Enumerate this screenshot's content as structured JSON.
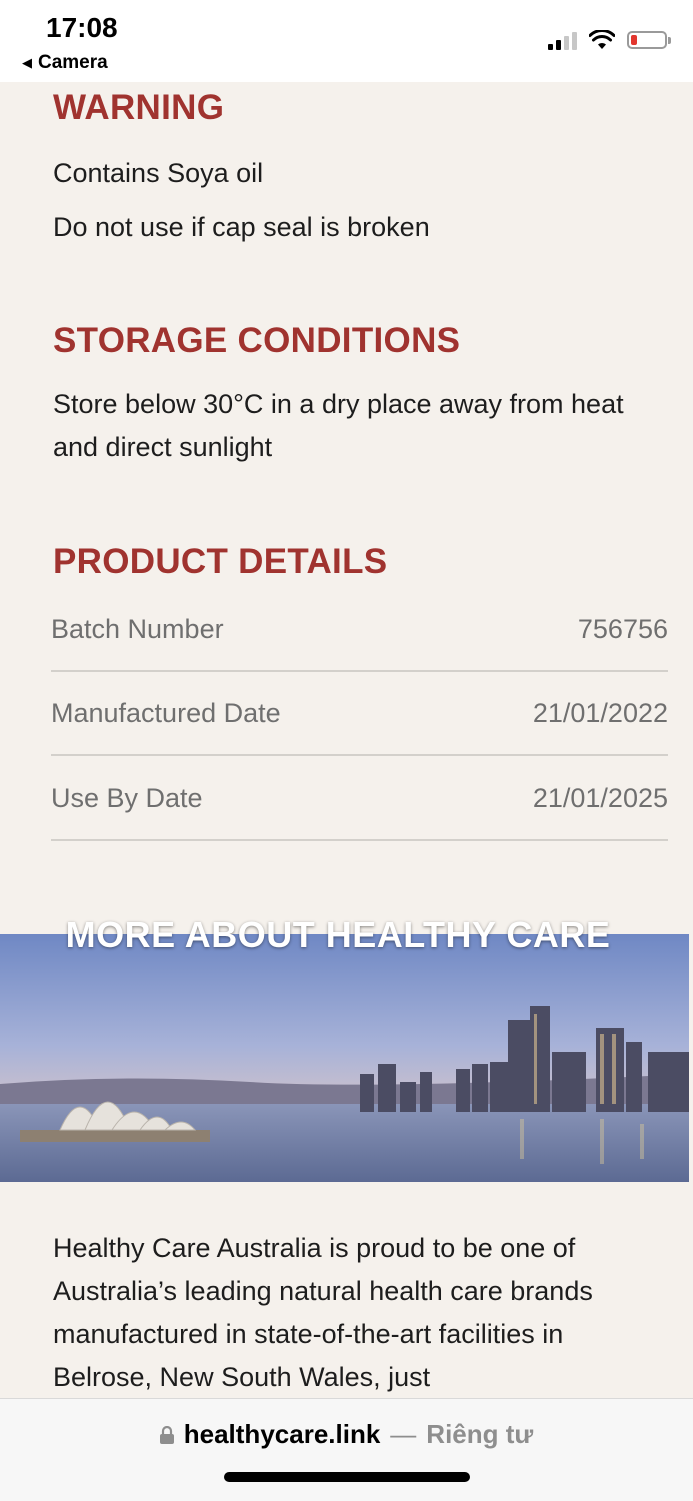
{
  "status_bar": {
    "time": "17:08",
    "back_label": "Camera",
    "icons": [
      "signal-icon",
      "wifi-icon",
      "battery-icon"
    ]
  },
  "warning": {
    "title": "WARNING",
    "lines": [
      "Contains Soya oil",
      "Do not use if cap seal is broken"
    ]
  },
  "storage": {
    "title": "STORAGE CONDITIONS",
    "text": "Store below 30°C in a dry place away from heat and direct sunlight"
  },
  "product_details": {
    "title": "PRODUCT DETAILS",
    "rows": [
      {
        "label": "Batch Number",
        "value": "756756"
      },
      {
        "label": "Manufactured Date",
        "value": "21/01/2022"
      },
      {
        "label": "Use By Date",
        "value": "21/01/2025"
      }
    ]
  },
  "banner": {
    "title": "MORE ABOUT HEALTHY CARE"
  },
  "about": {
    "text": "Healthy Care Australia is proud to be one of Australia’s leading natural health care brands manufactured in state-of-the-art facilities in Belrose, New South Wales, just"
  },
  "browser": {
    "domain": "healthycare.link",
    "separator": "—",
    "privacy_label": "Riêng tư"
  },
  "colors": {
    "heading": "#a0332f",
    "background": "#f5f1ec"
  }
}
